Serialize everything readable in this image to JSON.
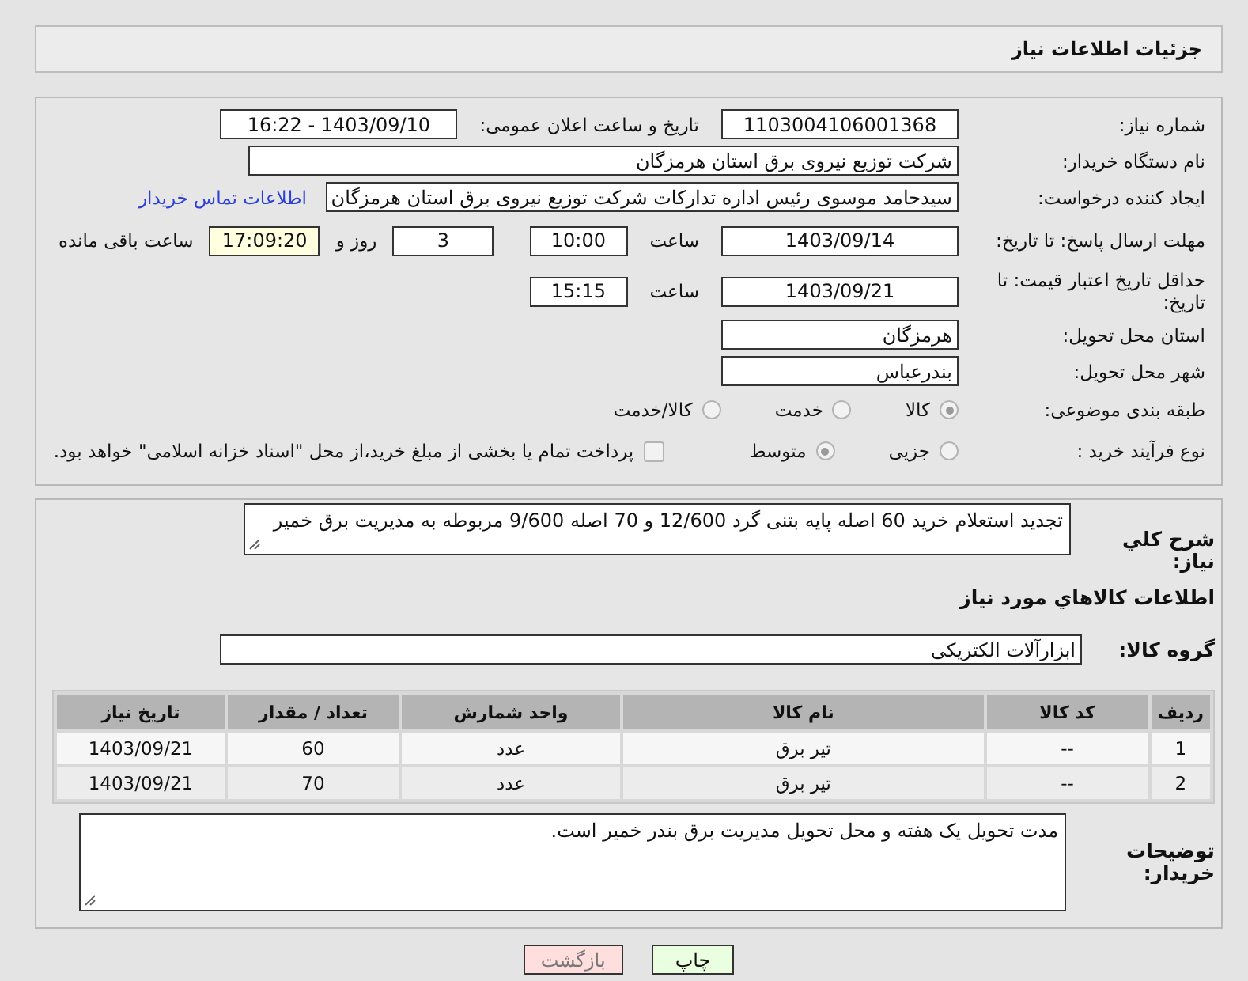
{
  "header": {
    "title": "جزئیات اطلاعات نیاز"
  },
  "need_number": {
    "label": "شماره نیاز:",
    "value": "1103004106001368"
  },
  "announce": {
    "label": "تاریخ و ساعت اعلان عمومی:",
    "value": "1403/09/10 - 16:22"
  },
  "buyer_org": {
    "label": "نام دستگاه خریدار:",
    "value": "شرکت توزیع نیروی برق استان هرمزگان"
  },
  "requester": {
    "label": "ایجاد کننده درخواست:",
    "value": "سیدحامد موسوی رئیس اداره تدارکات شرکت توزیع نیروی برق استان هرمزگان",
    "link": "اطلاعات تماس خریدار"
  },
  "reply_deadline": {
    "label": "مهلت ارسال پاسخ: تا تاریخ:",
    "date": "1403/09/14",
    "time_label": "ساعت",
    "time": "10:00",
    "days": "3",
    "days_label": "روز و",
    "remaining": "17:09:20",
    "remaining_label": "ساعت باقی مانده"
  },
  "price_validity": {
    "label": "حداقل تاریخ اعتبار قیمت: تا تاریخ:",
    "date": "1403/09/21",
    "time_label": "ساعت",
    "time": "15:15"
  },
  "province": {
    "label": "استان محل تحویل:",
    "value": "هرمزگان"
  },
  "city": {
    "label": "شهر محل تحویل:",
    "value": "بندرعباس"
  },
  "category": {
    "label": "طبقه بندی موضوعی:",
    "options": [
      {
        "label": "کالا",
        "selected": true
      },
      {
        "label": "خدمت",
        "selected": false
      },
      {
        "label": "کالا/خدمت",
        "selected": false
      }
    ]
  },
  "purchase_process": {
    "label": "نوع فرآیند خرید :",
    "options": [
      {
        "label": "جزیی",
        "selected": false
      },
      {
        "label": "متوسط",
        "selected": true
      }
    ],
    "payment_note": {
      "text": "پرداخت تمام یا بخشی از مبلغ خرید،از محل \"اسناد خزانه اسلامی\" خواهد بود.",
      "checked": false
    }
  },
  "description": {
    "label": "شرح کلي نياز:",
    "value": "تجدید استعلام خرید 60 اصله پایه بتنی گرد 12/600 و 70 اصله 9/600 مربوطه به مدیریت برق خمیر"
  },
  "items_heading": "اطلاعات کالاهاي مورد نياز",
  "goods_group": {
    "label": "گروه کالا:",
    "value": "ابزارآلات الکتریکی"
  },
  "table": {
    "columns": [
      "رديف",
      "کد کالا",
      "نام کالا",
      "واحد شمارش",
      "تعداد / مقدار",
      "تاریخ نیاز"
    ],
    "rows": [
      [
        "1",
        "--",
        "تیر برق",
        "عدد",
        "60",
        "1403/09/21"
      ],
      [
        "2",
        "--",
        "تیر برق",
        "عدد",
        "70",
        "1403/09/21"
      ]
    ]
  },
  "buyer_notes": {
    "label": "توضیحات خریدار:",
    "value": "مدت تحویل یک هفته و محل تحویل مدیریت برق بندر خمیر است."
  },
  "buttons": [
    {
      "label": "چاپ",
      "kind": "print"
    },
    {
      "label": "بازگشت",
      "kind": "back"
    }
  ]
}
